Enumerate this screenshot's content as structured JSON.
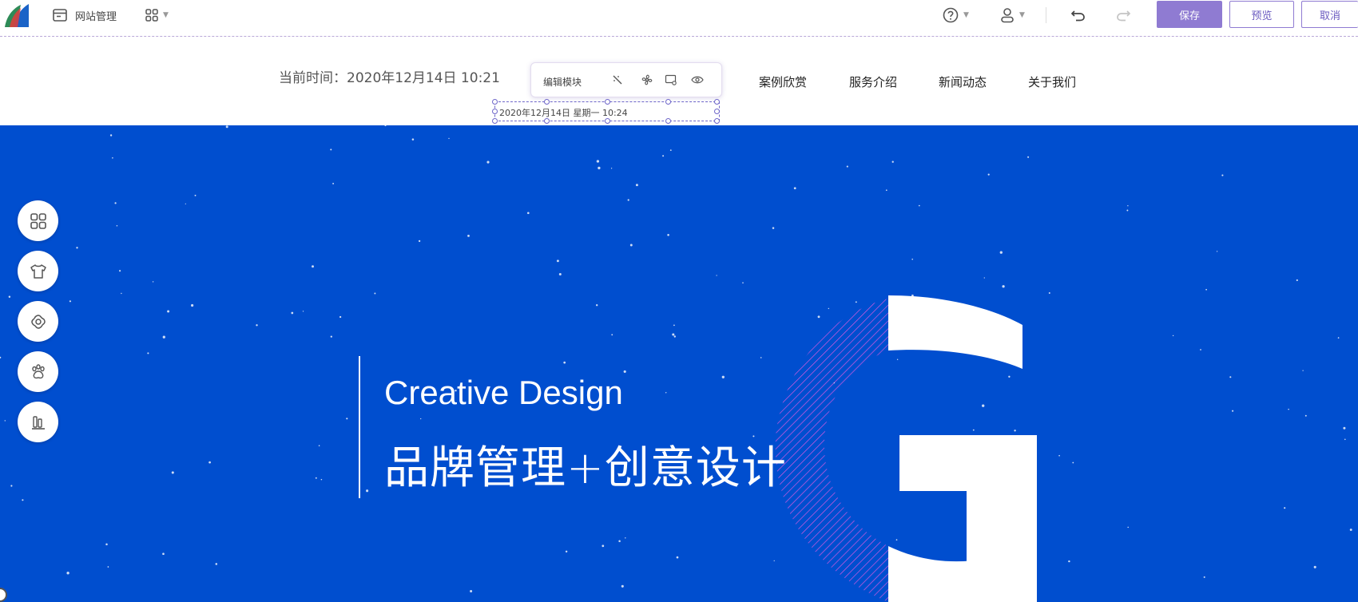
{
  "toolbar": {
    "site_manage_label": "网站管理",
    "save_label": "保存",
    "preview_label": "预览",
    "cancel_label": "取消"
  },
  "header": {
    "current_time_text": "当前时间：2020年12月14日 10:21",
    "nav": [
      "案例欣赏",
      "服务介绍",
      "新闻动态",
      "关于我们"
    ]
  },
  "module_editor": {
    "label": "编辑模块",
    "selected_text": "2020年12月14日 星期一 10:24"
  },
  "hero": {
    "title_en": "Creative Design",
    "title_cn": "品牌管理+创意设计",
    "background_color": "#004ecf",
    "big_letter": "G"
  },
  "side_tools": [
    "apps-icon",
    "tshirt-icon",
    "flower-icon",
    "paw-icon",
    "books-icon"
  ],
  "colors": {
    "accent": "#8f7bd2",
    "hero_blue": "#004ecf"
  }
}
